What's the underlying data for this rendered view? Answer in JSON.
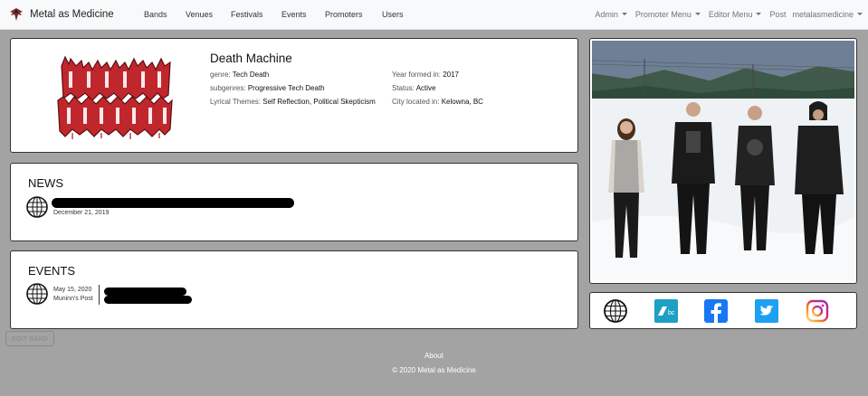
{
  "navbar": {
    "brand": "Metal as Medicine",
    "left_links": [
      "Bands",
      "Venues",
      "Festivals",
      "Events",
      "Promoters",
      "Users"
    ],
    "right_links": [
      {
        "label": "Admin",
        "dropdown": true
      },
      {
        "label": "Promoter Menu",
        "dropdown": true
      },
      {
        "label": "Editor Menu",
        "dropdown": true
      },
      {
        "label": "Post",
        "dropdown": false
      },
      {
        "label": "metalasmedicine",
        "dropdown": true
      }
    ]
  },
  "band": {
    "name": "Death Machine",
    "logo_text": "DEATH MACHINE",
    "genre_label": "genre:",
    "genre": "Tech Death",
    "subgenres_label": "subgenres:",
    "subgenres": "Progressive Tech Death",
    "themes_label": "Lyrical Themes:",
    "themes": "Self Reflection, Political Skepticism",
    "year_label": "Year formed in:",
    "year": "2017",
    "status_label": "Status:",
    "status": "Active",
    "city_label": "City located in:",
    "city": "Kelowna, BC"
  },
  "news": {
    "title": "NEWS",
    "date": "December 21, 2019"
  },
  "events": {
    "title": "EVENTS",
    "date": "May 15, 2020",
    "author": "Muninn's Post"
  },
  "social": [
    "globe-icon",
    "bandcamp-icon",
    "facebook-icon",
    "twitter-icon",
    "instagram-icon"
  ],
  "colors": {
    "background": "#a3a3a3",
    "logo_red": "#c0272d",
    "bandcamp": "#1da0c3",
    "facebook": "#1877f2",
    "twitter": "#1da1f2"
  },
  "edit_button": "EDIT BAND",
  "footer": {
    "about": "About",
    "copyright": "© 2020 Metal as Medicine"
  }
}
